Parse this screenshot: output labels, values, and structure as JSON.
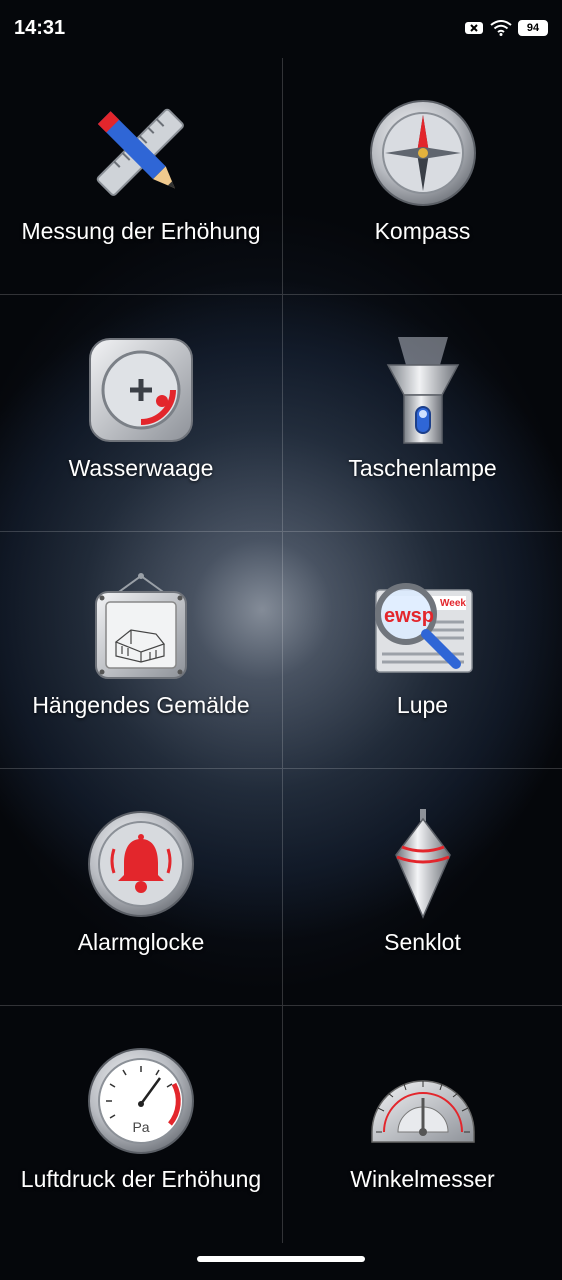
{
  "status_bar": {
    "time": "14:31",
    "battery": "94"
  },
  "tiles": [
    {
      "label": "Messung der Erhöhung",
      "icon": "ruler-pencil-icon"
    },
    {
      "label": "Kompass",
      "icon": "compass-icon"
    },
    {
      "label": "Wasserwaage",
      "icon": "spirit-level-icon"
    },
    {
      "label": "Taschenlampe",
      "icon": "flashlight-icon"
    },
    {
      "label": "Hängendes Gemälde",
      "icon": "hanging-picture-icon"
    },
    {
      "label": "Lupe",
      "icon": "magnifier-icon",
      "newspaper_text": "ewsp",
      "newspaper_tag": "Week"
    },
    {
      "label": "Alarmglocke",
      "icon": "alarm-bell-icon"
    },
    {
      "label": "Senklot",
      "icon": "plumb-bob-icon"
    },
    {
      "label": "Luftdruck der Erhöhung",
      "icon": "barometer-icon",
      "gauge_unit": "Pa"
    },
    {
      "label": "Winkelmesser",
      "icon": "protractor-icon"
    }
  ],
  "colors": {
    "accent_red": "#e3262c",
    "accent_blue": "#2f66d6",
    "metal": "#c9ccd1"
  }
}
